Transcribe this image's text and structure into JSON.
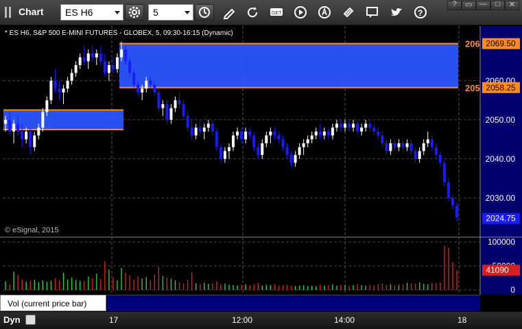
{
  "toolbar": {
    "title": "Chart",
    "symbol": "ES H6",
    "interval": "5",
    "icons": [
      "pipe-icon",
      "gear-icon",
      "clock-icon",
      "pencil-icon",
      "refresh-icon",
      "get-icon",
      "play-icon",
      "alert-icon",
      "link-icon",
      "comment-icon",
      "twitter-icon",
      "help-icon"
    ],
    "window_buttons": [
      "?",
      "▭",
      "—",
      "□",
      "✕"
    ]
  },
  "chart": {
    "header": "* ES H6, S&P 500 E-MINI FUTURES - GLOBEX, 5, 09:30-16:15 (Dynamic)",
    "copyright": "© eSignal, 2015",
    "price_axis": [
      "2060.00",
      "2050.00",
      "2040.00",
      "2030.00"
    ],
    "volume_axis": [
      "100000",
      "50000",
      "0"
    ],
    "x_ticks": [
      "17",
      "12:00",
      "14:00",
      "18"
    ],
    "markers": {
      "upper_price": "2069.50",
      "upper_left": "206",
      "lower_price": "2058.25",
      "lower_left": "205",
      "last_price": "2024.75",
      "last_volume": "41090"
    },
    "colors": {
      "up": "#ffffff",
      "down": "#1a1aff",
      "zone_fill": "#2b55ff",
      "zone_line": "#ff8c1a",
      "vol_up": "#2ecc40",
      "vol_down": "#d9201f"
    }
  },
  "bottom": {
    "study_tab": "Vol (current price bar)",
    "close": "×",
    "status": "Dyn"
  },
  "chart_data": {
    "type": "candlestick",
    "ylim": [
      2022,
      2072
    ],
    "zones": [
      {
        "from_bar": 0,
        "to_bar": 28,
        "low": 2047.5,
        "high": 2052.5
      },
      {
        "from_bar": 28,
        "to_bar": 119,
        "low": 2058.25,
        "high": 2069.5
      }
    ],
    "candles": [
      [
        2049,
        2051,
        2047,
        2050
      ],
      [
        2050,
        2052,
        2046,
        2047
      ],
      [
        2047,
        2050,
        2044,
        2049
      ],
      [
        2049,
        2051,
        2046,
        2047
      ],
      [
        2047,
        2049,
        2043,
        2045
      ],
      [
        2045,
        2048,
        2044,
        2047
      ],
      [
        2047,
        2048,
        2041,
        2043
      ],
      [
        2043,
        2047,
        2042,
        2046
      ],
      [
        2046,
        2049,
        2045,
        2048
      ],
      [
        2048,
        2053,
        2047,
        2052
      ],
      [
        2052,
        2056,
        2051,
        2055
      ],
      [
        2055,
        2061,
        2054,
        2060
      ],
      [
        2060,
        2063,
        2057,
        2058
      ],
      [
        2058,
        2060,
        2055,
        2057
      ],
      [
        2057,
        2059,
        2054,
        2058
      ],
      [
        2058,
        2061,
        2057,
        2060
      ],
      [
        2060,
        2063,
        2059,
        2062
      ],
      [
        2062,
        2065,
        2061,
        2064
      ],
      [
        2064,
        2067,
        2063,
        2066
      ],
      [
        2066,
        2069,
        2064,
        2065
      ],
      [
        2065,
        2068,
        2063,
        2067
      ],
      [
        2067,
        2069,
        2065,
        2066
      ],
      [
        2066,
        2068,
        2064,
        2067
      ],
      [
        2067,
        2069,
        2064,
        2065
      ],
      [
        2065,
        2067,
        2061,
        2062
      ],
      [
        2062,
        2065,
        2060,
        2064
      ],
      [
        2064,
        2066,
        2062,
        2063
      ],
      [
        2063,
        2067,
        2062,
        2066
      ],
      [
        2066,
        2070,
        2065,
        2068
      ],
      [
        2068,
        2069,
        2064,
        2065
      ],
      [
        2065,
        2066,
        2061,
        2062
      ],
      [
        2062,
        2063,
        2058,
        2059
      ],
      [
        2059,
        2060,
        2056,
        2057
      ],
      [
        2057,
        2059,
        2055,
        2058
      ],
      [
        2058,
        2061,
        2057,
        2060
      ],
      [
        2060,
        2061,
        2058,
        2059
      ],
      [
        2059,
        2060,
        2056,
        2057
      ],
      [
        2057,
        2058,
        2052,
        2053
      ],
      [
        2053,
        2055,
        2051,
        2054
      ],
      [
        2054,
        2055,
        2049,
        2050
      ],
      [
        2050,
        2054,
        2049,
        2053
      ],
      [
        2053,
        2056,
        2052,
        2055
      ],
      [
        2055,
        2057,
        2053,
        2054
      ],
      [
        2054,
        2055,
        2050,
        2051
      ],
      [
        2051,
        2052,
        2047,
        2048
      ],
      [
        2048,
        2050,
        2045,
        2046
      ],
      [
        2046,
        2049,
        2045,
        2048
      ],
      [
        2048,
        2050,
        2046,
        2047
      ],
      [
        2047,
        2049,
        2045,
        2048
      ],
      [
        2048,
        2050,
        2047,
        2049
      ],
      [
        2049,
        2050,
        2046,
        2047
      ],
      [
        2047,
        2048,
        2042,
        2043
      ],
      [
        2043,
        2044,
        2039,
        2040
      ],
      [
        2040,
        2043,
        2039,
        2042
      ],
      [
        2042,
        2044,
        2040,
        2043
      ],
      [
        2043,
        2047,
        2042,
        2046
      ],
      [
        2046,
        2048,
        2045,
        2047
      ],
      [
        2047,
        2048,
        2044,
        2045
      ],
      [
        2045,
        2048,
        2044,
        2047
      ],
      [
        2047,
        2048,
        2045,
        2046
      ],
      [
        2046,
        2047,
        2042,
        2043
      ],
      [
        2043,
        2044,
        2040,
        2041
      ],
      [
        2041,
        2045,
        2040,
        2044
      ],
      [
        2044,
        2047,
        2043,
        2046
      ],
      [
        2046,
        2048,
        2044,
        2047
      ],
      [
        2047,
        2048,
        2045,
        2046
      ],
      [
        2046,
        2047,
        2044,
        2045
      ],
      [
        2045,
        2046,
        2042,
        2043
      ],
      [
        2043,
        2044,
        2040,
        2041
      ],
      [
        2041,
        2042,
        2038,
        2039
      ],
      [
        2039,
        2042,
        2038,
        2041
      ],
      [
        2041,
        2044,
        2040,
        2043
      ],
      [
        2043,
        2045,
        2041,
        2044
      ],
      [
        2044,
        2046,
        2043,
        2045
      ],
      [
        2045,
        2047,
        2044,
        2046
      ],
      [
        2046,
        2048,
        2045,
        2047
      ],
      [
        2047,
        2049,
        2045,
        2046
      ],
      [
        2046,
        2048,
        2045,
        2047
      ],
      [
        2047,
        2048,
        2045,
        2046
      ],
      [
        2046,
        2049,
        2045,
        2048
      ],
      [
        2048,
        2050,
        2047,
        2049
      ],
      [
        2049,
        2050,
        2047,
        2048
      ],
      [
        2048,
        2050,
        2047,
        2049
      ],
      [
        2049,
        2050,
        2047,
        2048
      ],
      [
        2048,
        2050,
        2047,
        2049
      ],
      [
        2049,
        2050,
        2046,
        2047
      ],
      [
        2047,
        2049,
        2046,
        2048
      ],
      [
        2048,
        2050,
        2047,
        2049
      ],
      [
        2049,
        2050,
        2047,
        2048
      ],
      [
        2048,
        2049,
        2046,
        2047
      ],
      [
        2047,
        2048,
        2045,
        2046
      ],
      [
        2046,
        2047,
        2043,
        2044
      ],
      [
        2044,
        2045,
        2041,
        2042
      ],
      [
        2042,
        2045,
        2041,
        2044
      ],
      [
        2044,
        2045,
        2042,
        2043
      ],
      [
        2043,
        2045,
        2042,
        2044
      ],
      [
        2044,
        2045,
        2042,
        2043
      ],
      [
        2043,
        2045,
        2042,
        2044
      ],
      [
        2044,
        2045,
        2041,
        2042
      ],
      [
        2042,
        2043,
        2039,
        2040
      ],
      [
        2040,
        2043,
        2039,
        2042
      ],
      [
        2042,
        2045,
        2041,
        2044
      ],
      [
        2044,
        2047,
        2043,
        2045
      ],
      [
        2045,
        2046,
        2042,
        2043
      ],
      [
        2043,
        2044,
        2040,
        2041
      ],
      [
        2041,
        2042,
        2038,
        2039
      ],
      [
        2039,
        2040,
        2033,
        2034
      ],
      [
        2034,
        2035,
        2029,
        2030
      ],
      [
        2030,
        2031,
        2027,
        2028
      ],
      [
        2028,
        2029,
        2024,
        2025
      ]
    ],
    "volumes": [
      18000,
      12000,
      38000,
      31000,
      22000,
      17000,
      19000,
      21000,
      16000,
      20000,
      17000,
      19000,
      24000,
      20000,
      36000,
      22000,
      26000,
      21000,
      19000,
      18000,
      28000,
      25000,
      34000,
      23000,
      60000,
      42000,
      26000,
      20000,
      46000,
      36000,
      30000,
      22000,
      28000,
      24000,
      27000,
      20000,
      32000,
      48000,
      29000,
      26000,
      23000,
      20000,
      16000,
      14000,
      21000,
      37000,
      14000,
      12000,
      15000,
      13000,
      14000,
      18000,
      12000,
      13000,
      11000,
      10000,
      9000,
      11000,
      12000,
      10000,
      12000,
      14000,
      9000,
      11000,
      10000,
      12000,
      9000,
      10000,
      11000,
      9000,
      8000,
      9000,
      10000,
      8000,
      9000,
      8000,
      11000,
      9000,
      10000,
      12000,
      9000,
      10000,
      11000,
      9000,
      10000,
      12000,
      10000,
      9000,
      11000,
      10000,
      12000,
      14000,
      11000,
      12000,
      10000,
      11000,
      12000,
      15000,
      14000,
      13000,
      16000,
      13000,
      12000,
      15000,
      14000,
      16000,
      92000,
      88000,
      58000,
      41090
    ]
  }
}
